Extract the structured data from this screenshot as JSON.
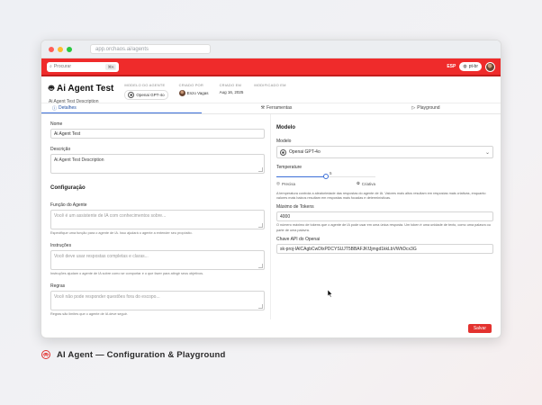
{
  "browser": {
    "url": "app.orchaos.ai/agents"
  },
  "topbar": {
    "search_placeholder": "Procurar",
    "search_shortcut": "⌘K",
    "lang_code": "ESP",
    "lang_button": "pt-br"
  },
  "agent": {
    "title": "Ai Agent Test",
    "description": "Ai Agent Test Description",
    "meta": {
      "model_label": "MODELO DO AGENTE",
      "model_value": "Openai GPT-4o",
      "created_by_label": "CRIADO POR",
      "created_by_value": "Enzo Vagas",
      "created_at_label": "CRIADO EM",
      "created_at_value": "Aug 16, 2025",
      "modified_at_label": "MODIFICADO EM"
    }
  },
  "tabs": [
    {
      "label": "Detalhes"
    },
    {
      "label": "Ferramentas"
    },
    {
      "label": "Playground"
    }
  ],
  "form": {
    "name_label": "Nome",
    "name_value": "Ai Agent Test",
    "desc_label": "Descrição",
    "desc_value": "Ai Agent Test Description",
    "config_title": "Configuração",
    "role_label": "Função do Agente",
    "role_placeholder": "Você é um assistente de IA com conhecimentos sobre...",
    "role_help": "Especifique uma função para o agente de IA. Isso ajudará o agente a entender seu propósito.",
    "instr_label": "Instruções",
    "instr_placeholder": "Você deve usar respostas completas e claras...",
    "instr_help": "Instruções ajudam o agente de IA sobre como se comportar e o que fazer para atingir seus objetivos.",
    "rules_label": "Regras",
    "rules_placeholder": "Você não pode responder questões fora do escopo...",
    "rules_help": "Regras são limites que o agente de IA deve seguir."
  },
  "model_panel": {
    "title": "Modelo",
    "model_label": "Modelo",
    "model_value": "Openai GPT-4o",
    "temp_label": "Temperature",
    "temp_value": 0.5,
    "temp_value_text": "5",
    "temp_left": "Precisa",
    "temp_right": "Criativa",
    "temp_help": "A temperatura controla a aleatoriedade das respostas do agente de IA. Valores mais altos resultam em respostas mais criativas, enquanto valores mais baixos resultam em respostas mais focadas e determinísticas.",
    "tokens_label": "Máximo de Tokens",
    "tokens_value": "4000",
    "tokens_help": "O número máximo de tokens que o agente de IA pode usar em uma única resposta. Um token é uma unidade de texto, como uma palavra ou parte de uma palavra.",
    "key_label": "Chave API do Openai",
    "key_value": "sk-proj-IAlCAgbCwDlxPDCYSUJT5BBAFJKfJjmgd1kkLbVWhDcx3G"
  },
  "actions": {
    "save_label": "Salvar"
  },
  "caption": {
    "text": "AI Agent — Configuration & Playground"
  },
  "colors": {
    "brand_red": "#ef2b2b",
    "accent_blue": "#3b6fd8"
  }
}
